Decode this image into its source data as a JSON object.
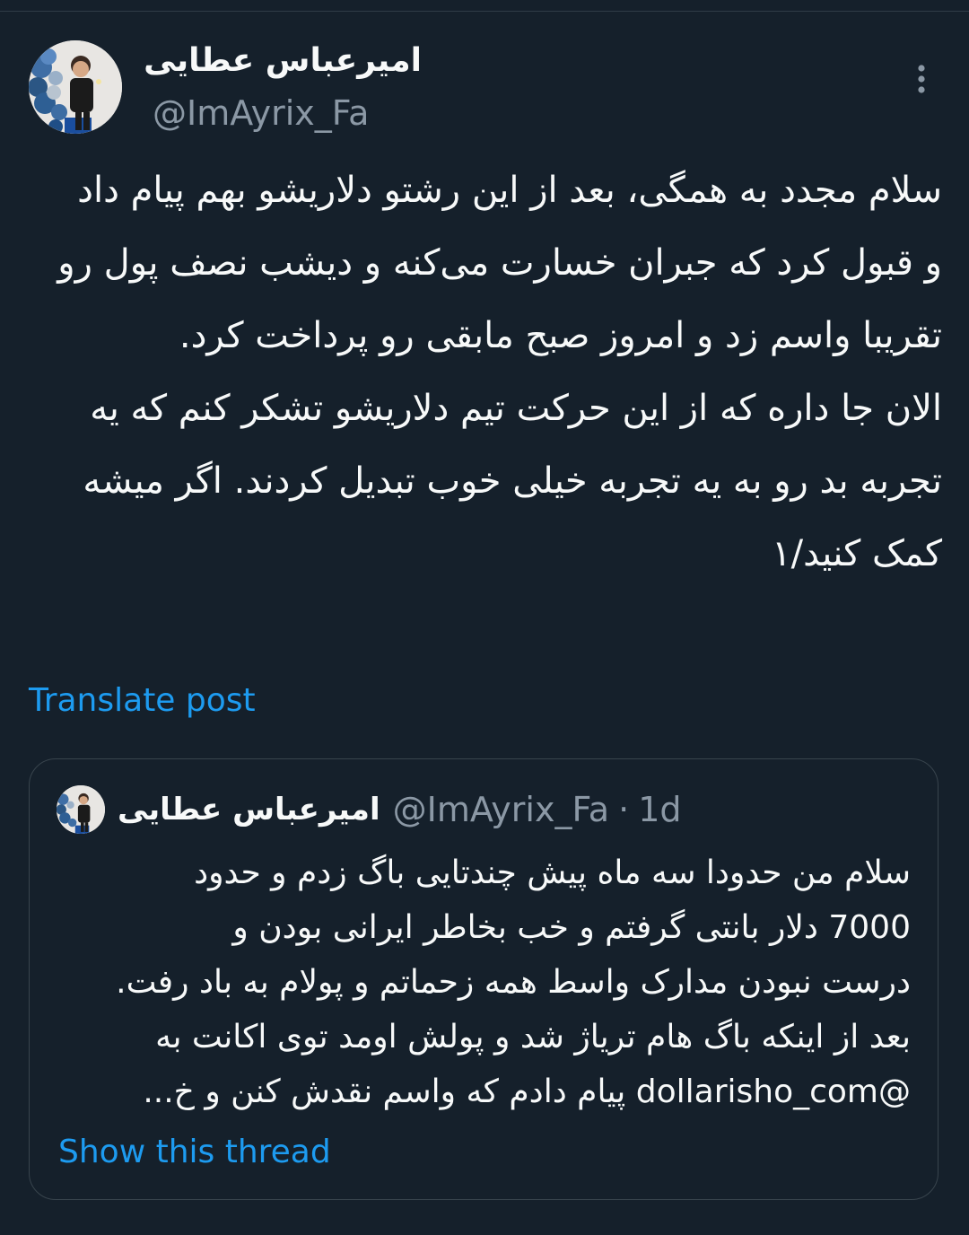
{
  "tweet": {
    "author": {
      "display_name": "امیرعباس عطایی",
      "handle": "@ImAyrix_Fa"
    },
    "body_paragraphs": [
      "سلام مجدد به همگی، بعد از این رشتو دلاریشو بهم پیام داد و قبول کرد که جبران خسارت می‌کنه و دیشب نصف پول رو تقریبا واسم زد و امروز صبح مابقی رو پرداخت کرد.",
      "الان جا داره که از این حرکت تیم دلاریشو تشکر کنم که یه تجربه بد رو به یه تجربه خیلی خوب تبدیل کردند. اگر میشه کمک کنید/۱"
    ],
    "translate_label": "Translate post",
    "more_icon": "more-vertical-icon"
  },
  "quote": {
    "author": {
      "display_name": "امیرعباس عطایی",
      "handle": "@ImAyrix_Fa"
    },
    "separator": "·",
    "time": "1d",
    "body_lines": [
      "سلام من حدودا سه ماه پیش چندتایی باگ زدم و حدود",
      "7000 دلار بانتی گرفتم و خب بخاطر ایرانی بودن و",
      "درست نبودن مدارک واسط همه زحماتم و پولام به باد رفت.",
      "بعد از اینکه باگ هام تریاژ شد و پولش اومد توی اکانت به",
      "@dollarisho_com پیام دادم که واسم نقدش کنن و خ..."
    ],
    "show_thread_label": "Show this thread"
  },
  "colors": {
    "background": "#15202b",
    "text": "#f7f9f9",
    "secondary_text": "#8b98a5",
    "link": "#1d9bf0",
    "border": "#38444d"
  }
}
